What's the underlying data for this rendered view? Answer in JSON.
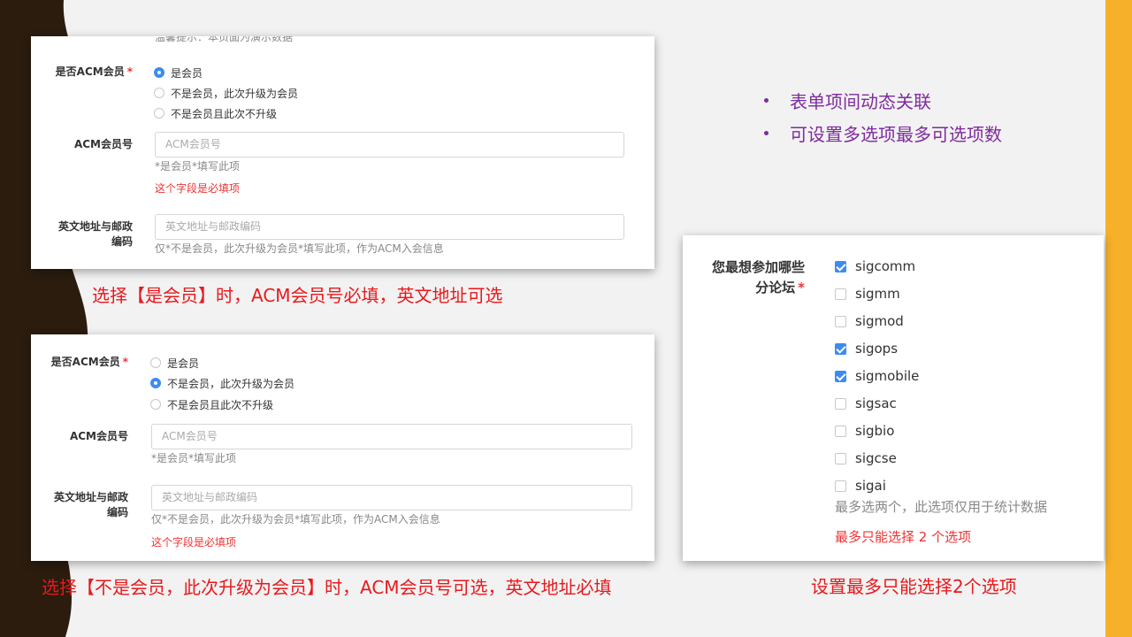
{
  "bullets": [
    "表单项间动态关联",
    "可设置多选项最多可选项数"
  ],
  "panel_a": {
    "cut_text": "温馨提示：本页面为演示数据",
    "member_label": "是否ACM会员",
    "required_mark": "*",
    "options": [
      {
        "label": "是会员",
        "selected": true
      },
      {
        "label": "不是会员，此次升级为会员",
        "selected": false
      },
      {
        "label": "不是会员且此次不升级",
        "selected": false
      }
    ],
    "member_no_label": "ACM会员号",
    "member_no_placeholder": "ACM会员号",
    "member_no_hint": "*是会员*填写此项",
    "member_no_error": "这个字段是必填项",
    "address_label_1": "英文地址与邮政",
    "address_label_2": "编码",
    "address_placeholder": "英文地址与邮政编码",
    "address_hint": "仅*不是会员，此次升级为会员*填写此项，作为ACM入会信息"
  },
  "caption_a": "选择【是会员】时，ACM会员号必填，英文地址可选",
  "panel_b": {
    "member_label": "是否ACM会员",
    "required_mark": "*",
    "options": [
      {
        "label": "是会员",
        "selected": false
      },
      {
        "label": "不是会员，此次升级为会员",
        "selected": true
      },
      {
        "label": "不是会员且此次不升级",
        "selected": false
      }
    ],
    "member_no_label": "ACM会员号",
    "member_no_placeholder": "ACM会员号",
    "member_no_hint": "*是会员*填写此项",
    "address_label_1": "英文地址与邮政",
    "address_label_2": "编码",
    "address_placeholder": "英文地址与邮政编码",
    "address_hint": "仅*不是会员，此次升级为会员*填写此项，作为ACM入会信息",
    "address_error": "这个字段是必填项"
  },
  "caption_b": "选择【不是会员，此次升级为会员】时，ACM会员号可选，英文地址必填",
  "panel_c": {
    "label_1": "您最想参加哪些",
    "label_2": "分论坛",
    "required_mark": "*",
    "options": [
      {
        "label": "sigcomm",
        "checked": true
      },
      {
        "label": "sigmm",
        "checked": false
      },
      {
        "label": "sigmod",
        "checked": false
      },
      {
        "label": "sigops",
        "checked": true
      },
      {
        "label": "sigmobile",
        "checked": true
      },
      {
        "label": "sigsac",
        "checked": false
      },
      {
        "label": "sigbio",
        "checked": false
      },
      {
        "label": "sigcse",
        "checked": false
      },
      {
        "label": "sigai",
        "checked": false
      }
    ],
    "hint": "最多选两个，此选项仅用于统计数据",
    "error": "最多只能选择 2 个选项"
  },
  "caption_c": "设置最多只能选择2个选项",
  "colors": {
    "accent_blue": "#3c8cf0",
    "error_red": "#e33333",
    "caption_red": "#e8191d",
    "bullet_purple": "#7f2b9e",
    "right_bar": "#f6b02a",
    "dark_shape": "#2b1c0e"
  }
}
